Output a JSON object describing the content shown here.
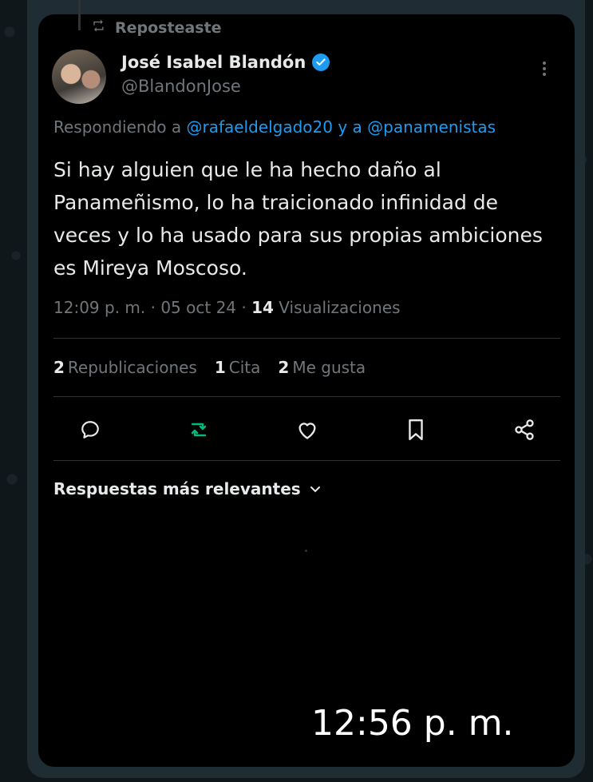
{
  "repost": {
    "label": "Reposteaste"
  },
  "author": {
    "name": "José Isabel Blandón",
    "handle": "@BlandonJose"
  },
  "reply_context": {
    "prefix": "Respondiendo a ",
    "mention1": "@rafaeldelgado20",
    "connector": " y a ",
    "mention2": "@panamenistas"
  },
  "tweet": {
    "text": "Si hay alguien que le ha hecho daño al Panameñismo, lo ha traicionado infinidad de veces y lo ha usado para sus propias ambiciones es Mireya Moscoso."
  },
  "meta": {
    "time": "12:09 p. m.",
    "sep1": " · ",
    "date": "05 oct 24",
    "sep2": " · ",
    "views_count": "14",
    "views_label": " Visualizaciones"
  },
  "stats": {
    "reposts_count": "2",
    "reposts_label": "Republicaciones",
    "quotes_count": "1",
    "quotes_label": "Cita",
    "likes_count": "2",
    "likes_label": "Me gusta"
  },
  "actions": {
    "icons": [
      "reply-icon",
      "repost-icon",
      "like-icon",
      "bookmark-icon",
      "share-icon"
    ],
    "repost_active_color": "#00ba7c"
  },
  "sort": {
    "label": "Respuestas más relevantes"
  },
  "message_time": "12:56 p. m.",
  "colors": {
    "accent": "#1d9bf0",
    "muted": "#71767b",
    "text": "#e7e9ea"
  }
}
